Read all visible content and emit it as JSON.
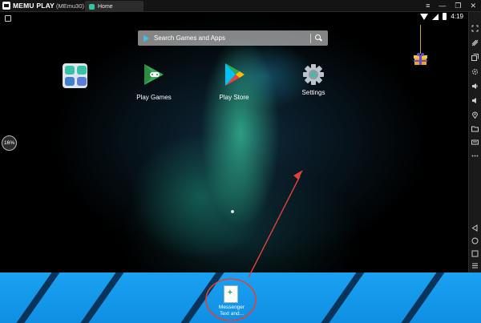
{
  "titlebar": {
    "logo_text": "MEMU PLAY",
    "instance": "(MEmu30)",
    "tab_label": "Home",
    "controls": [
      "≡",
      "—",
      "❐",
      "✕"
    ]
  },
  "status_bar": {
    "time": "4:19"
  },
  "search": {
    "placeholder": "Search Games and Apps"
  },
  "apps": [
    {
      "label": ""
    },
    {
      "label": "Play Games"
    },
    {
      "label": "Play Store"
    },
    {
      "label": "Settings"
    }
  ],
  "progress_badge": "16%",
  "sidebar_icons": [
    "expand-icon",
    "shake-icon",
    "multi-window-icon",
    "settings-icon",
    "volume-up-icon",
    "volume-down-icon",
    "location-icon",
    "folder-icon",
    "rotate-icon",
    "more-icon",
    "back-icon",
    "home-icon",
    "recents-icon",
    "menu-icon"
  ],
  "desktop": {
    "file_label": "Messenger Text and..."
  },
  "colors": {
    "accent": "#37c2a6",
    "desktop_blue": "#1ba1f2",
    "annotation_red": "#e0413a"
  }
}
